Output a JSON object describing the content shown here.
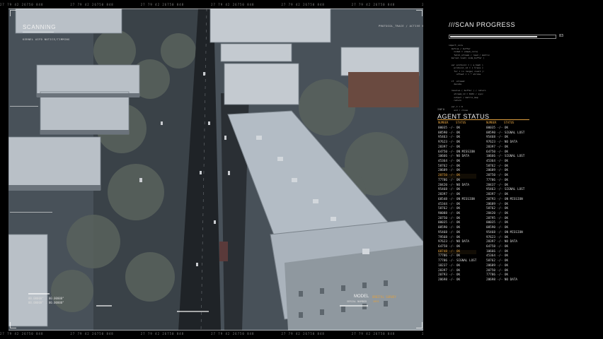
{
  "hud": {
    "scanning_label": "SCANNING",
    "tick_text": "27  79  42  26750  848",
    "left_tiny_text": "KERNEL AIFD NOTICE/TIMMING",
    "right_tiny_text": "PROTOCOL_TRACE / ACTIVE NODE",
    "coords": [
      "00.00000° : 00.00000°",
      "00.00000° : 00.00000°"
    ],
    "model_label": "MODEL",
    "model_value": "ORBITAL SURVEY",
    "serial_label": "SERIAL NUMBER",
    "serial_value": "2891"
  },
  "scan_progress": {
    "title": "///SCAN PROGRESS",
    "value": 83
  },
  "code_block": "import_core\n  define / buffer\n    nodeA = (mapA_core)\n    fetch_stream / read / matrix\n  kernel.load( node_buffer )\n\n  var protocol = ( a_hash )\n    protocol_id = [ trace ]\n    for i in range( count ):\n      offset = i * stride\n\n  if  stream:\n    decode\n\n  resolve ( buffer ) / return\n    stream_id = 0x01 / sync\n    output / matrix_map\n    return\n\n  var_t = 0\n    end / close",
  "agent_status": {
    "title": "AGENT STATUS",
    "label_small": "INFO",
    "headers": [
      "NUMBER",
      "STATUS",
      "NUMBER",
      "STATUS"
    ],
    "left_rows": [
      "00035 -/- OK",
      "08590 -/- OK",
      "95463 -/- OK",
      "97623 -/- OK",
      "28397 -/- OK",
      "64750 -/- ON MISSION",
      "10666 -/- NO DATA",
      "45364 -/- OK",
      "58762 -/- OK",
      "28689 -/- OK",
      "20750 -/- OK",
      "77786 -/- OK",
      "28420 -/- NO DATA",
      "95468 -/- OK",
      "28397 -/- OK",
      "68548 -/- ON MISSION",
      "45344 -/- OK",
      "58762 -/- OK",
      "90088 -/- OK",
      "20750 -/- OK",
      "00035 -/- OK",
      "08590 -/- OK",
      "95468 -/- OK",
      "79568 -/- OK",
      "97623 -/- NO DATA",
      "64758 -/- OK",
      "68748 -/- OK",
      "77786 -/- OK",
      "77786 -/- SIGNAL LOST",
      "18237 -/- OK",
      "28397 -/- OK",
      "20793 -/- OK",
      "28698 -/- OK"
    ],
    "right_rows": [
      "00035 -/- OK",
      "08590 -/- SIGNAL LOST",
      "95468 -/- OK",
      "97623 -/- NO DATA",
      "28397 -/- OK",
      "64750 -/- OK",
      "10666 -/- SIGNAL LOST",
      "45364 -/- OK",
      "58762 -/- OK",
      "28689 -/- OK",
      "20750 -/- OK",
      "77786 -/- OK",
      "28437 -/- OK",
      "95463 -/- SIGNAL LOST",
      "28397 -/- OK",
      "20793 -/- ON MISSION",
      "28689 -/- OK",
      "58762 -/- OK",
      "28420 -/- OK",
      "28795 -/- OK",
      "00035 -/- OK",
      "08590 -/- OK",
      "95468 -/- ON MISSION",
      "97623 -/- OK",
      "28397 -/- NO DATA",
      "64758 -/- OK",
      "10666 -/- OK",
      "45364 -/- OK",
      "58762 -/- OK",
      "28689 -/- OK",
      "20750 -/- OK",
      "77786 -/- OK",
      "28698 -/- NO DATA"
    ],
    "highlight_left_index": [
      10,
      26
    ],
    "highlight_color": "#e0a040"
  },
  "colors": {
    "accent": "#e0a040",
    "panel_bg": "#000000",
    "text": "#e8e8e8"
  }
}
